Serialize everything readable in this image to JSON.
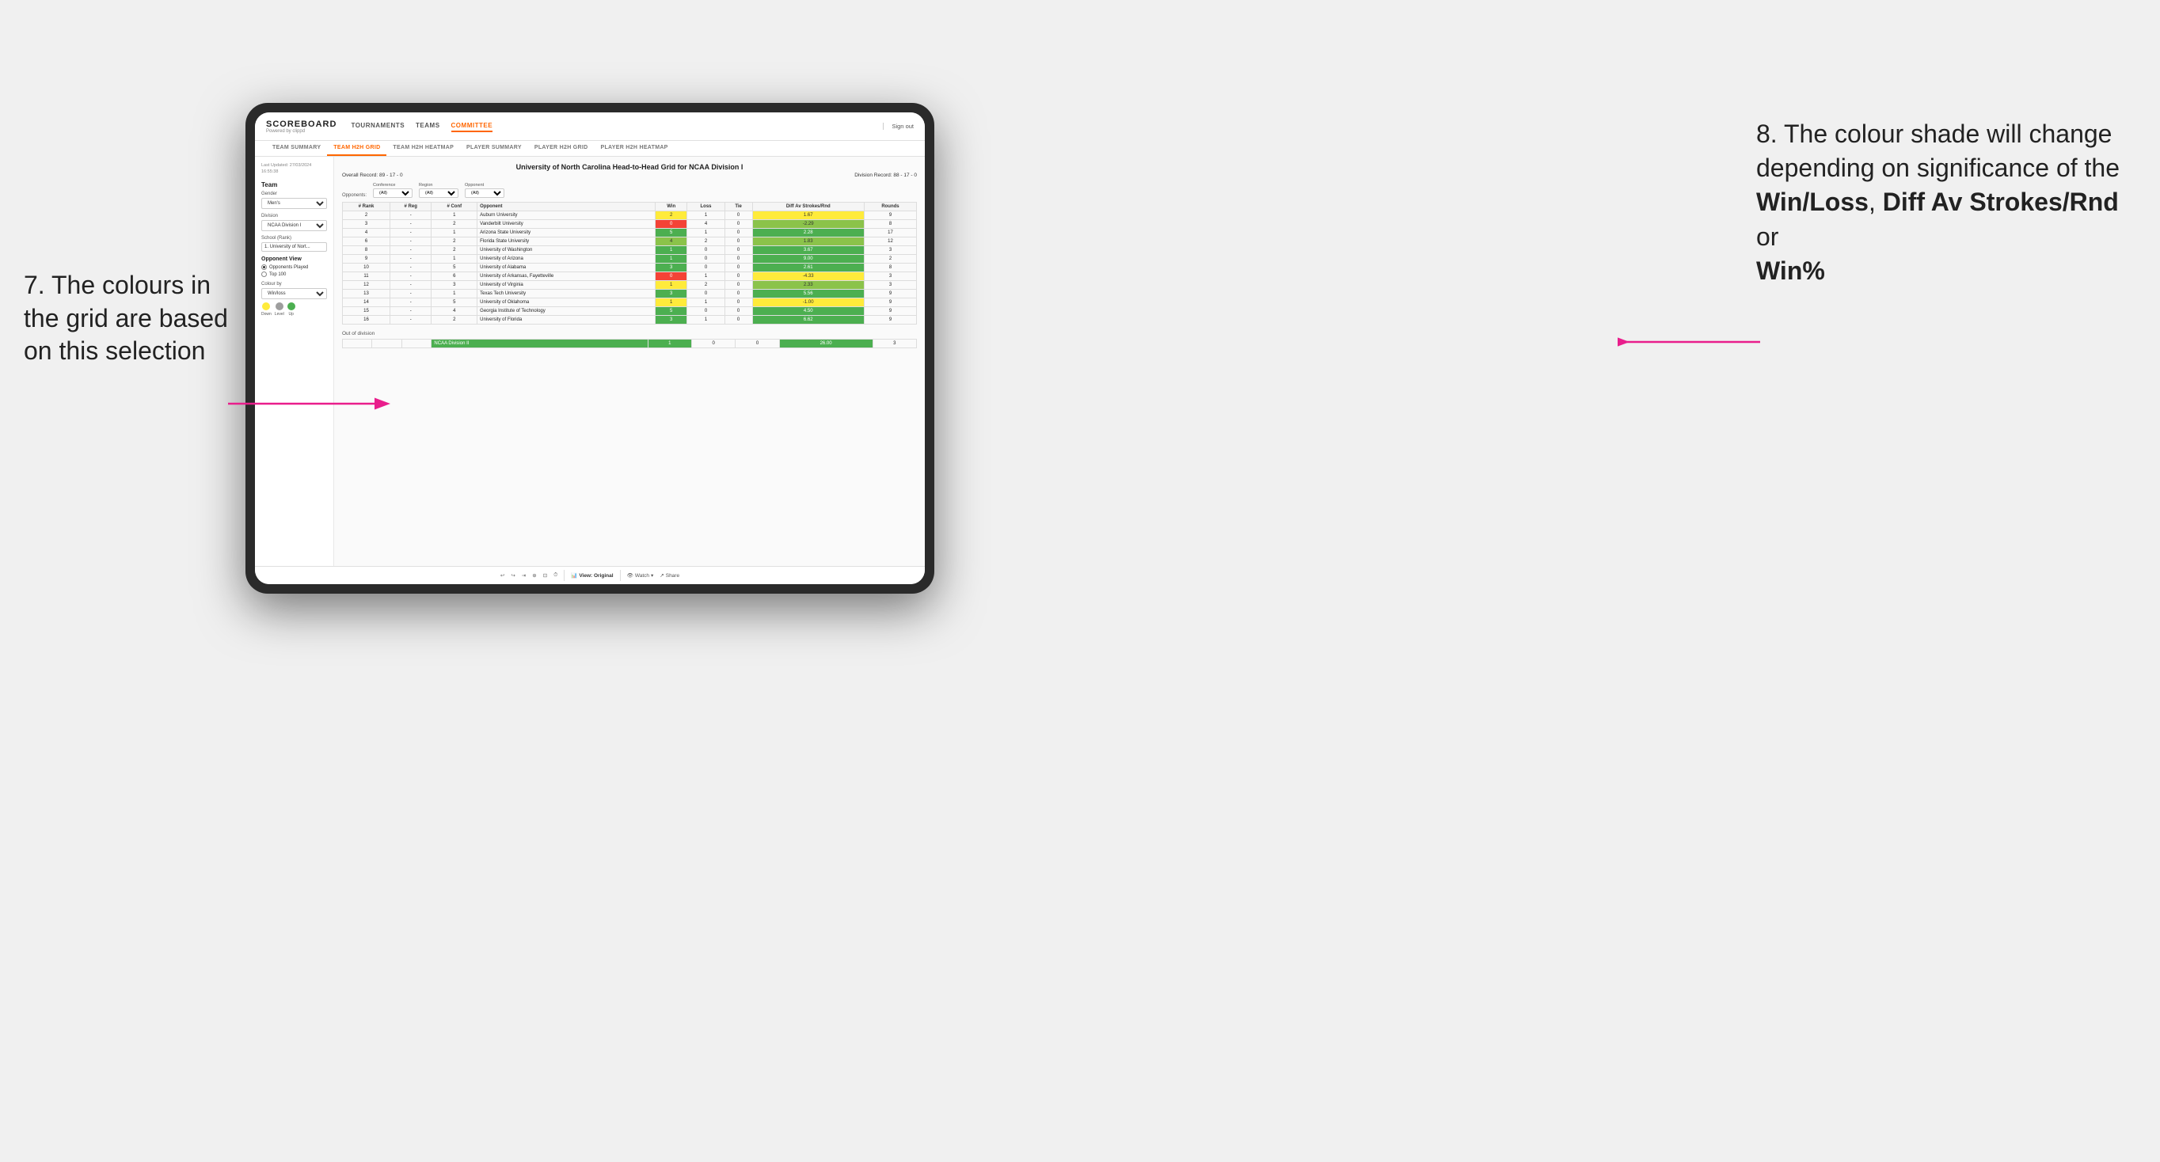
{
  "page": {
    "background": "#f0f0f0"
  },
  "annotations": {
    "left": {
      "number": "7.",
      "text": "The colours in the grid are based on this selection"
    },
    "right": {
      "number": "8.",
      "intro": "The colour shade will change depending on significance of the",
      "bold1": "Win/Loss",
      "sep1": ", ",
      "bold2": "Diff Av Strokes/Rnd",
      "sep2": " or",
      "bold3": "Win%"
    }
  },
  "app": {
    "logo": "SCOREBOARD",
    "logo_sub": "Powered by clippd",
    "nav": [
      {
        "label": "TOURNAMENTS",
        "active": false
      },
      {
        "label": "TEAMS",
        "active": false
      },
      {
        "label": "COMMITTEE",
        "active": true
      }
    ],
    "sign_out": "Sign out",
    "sub_nav": [
      {
        "label": "TEAM SUMMARY",
        "active": false
      },
      {
        "label": "TEAM H2H GRID",
        "active": true
      },
      {
        "label": "TEAM H2H HEATMAP",
        "active": false
      },
      {
        "label": "PLAYER SUMMARY",
        "active": false
      },
      {
        "label": "PLAYER H2H GRID",
        "active": false
      },
      {
        "label": "PLAYER H2H HEATMAP",
        "active": false
      }
    ]
  },
  "sidebar": {
    "last_updated_label": "Last Updated: 27/03/2024",
    "last_updated_time": "16:55:38",
    "team_label": "Team",
    "gender_label": "Gender",
    "gender_value": "Men's",
    "division_label": "Division",
    "division_value": "NCAA Division I",
    "school_label": "School (Rank)",
    "school_value": "1. University of Nort...",
    "opponent_view_label": "Opponent View",
    "opponent_options": [
      {
        "label": "Opponents Played",
        "selected": true
      },
      {
        "label": "Top 100",
        "selected": false
      }
    ],
    "colour_by_label": "Colour by",
    "colour_by_value": "Win/loss",
    "legend": [
      {
        "label": "Down",
        "color": "#ffeb3b"
      },
      {
        "label": "Level",
        "color": "#9e9e9e"
      },
      {
        "label": "Up",
        "color": "#4caf50"
      }
    ]
  },
  "grid": {
    "title": "University of North Carolina Head-to-Head Grid for NCAA Division I",
    "overall_record_label": "Overall Record:",
    "overall_record_value": "89 - 17 - 0",
    "division_record_label": "Division Record:",
    "division_record_value": "88 - 17 - 0",
    "filters": {
      "conference_label": "Conference",
      "conference_value": "(All)",
      "region_label": "Region",
      "region_value": "(All)",
      "opponent_label": "Opponent",
      "opponent_value": "(All)",
      "opponents_label": "Opponents:"
    },
    "columns": [
      "# Rank",
      "# Reg",
      "# Conf",
      "Opponent",
      "Win",
      "Loss",
      "Tie",
      "Diff Av Strokes/Rnd",
      "Rounds"
    ],
    "rows": [
      {
        "rank": "2",
        "reg": "-",
        "conf": "1",
        "opponent": "Auburn University",
        "win": "2",
        "loss": "1",
        "tie": "0",
        "diff": "1.67",
        "rounds": "9",
        "win_color": "yellow",
        "diff_color": "yellow"
      },
      {
        "rank": "3",
        "reg": "-",
        "conf": "2",
        "opponent": "Vanderbilt University",
        "win": "0",
        "loss": "4",
        "tie": "0",
        "diff": "-2.29",
        "rounds": "8",
        "win_color": "red",
        "diff_color": "green-mid"
      },
      {
        "rank": "4",
        "reg": "-",
        "conf": "1",
        "opponent": "Arizona State University",
        "win": "5",
        "loss": "1",
        "tie": "0",
        "diff": "2.28",
        "rounds": "17",
        "win_color": "green-dark",
        "diff_color": "green-dark"
      },
      {
        "rank": "6",
        "reg": "-",
        "conf": "2",
        "opponent": "Florida State University",
        "win": "4",
        "loss": "2",
        "tie": "0",
        "diff": "1.83",
        "rounds": "12",
        "win_color": "green-mid",
        "diff_color": "green-mid"
      },
      {
        "rank": "8",
        "reg": "-",
        "conf": "2",
        "opponent": "University of Washington",
        "win": "1",
        "loss": "0",
        "tie": "0",
        "diff": "3.67",
        "rounds": "3",
        "win_color": "green-dark",
        "diff_color": "green-dark"
      },
      {
        "rank": "9",
        "reg": "-",
        "conf": "1",
        "opponent": "University of Arizona",
        "win": "1",
        "loss": "0",
        "tie": "0",
        "diff": "9.00",
        "rounds": "2",
        "win_color": "green-dark",
        "diff_color": "green-dark"
      },
      {
        "rank": "10",
        "reg": "-",
        "conf": "5",
        "opponent": "University of Alabama",
        "win": "3",
        "loss": "0",
        "tie": "0",
        "diff": "2.61",
        "rounds": "8",
        "win_color": "green-dark",
        "diff_color": "green-dark"
      },
      {
        "rank": "11",
        "reg": "-",
        "conf": "6",
        "opponent": "University of Arkansas, Fayetteville",
        "win": "0",
        "loss": "1",
        "tie": "0",
        "diff": "-4.33",
        "rounds": "3",
        "win_color": "red",
        "diff_color": "yellow"
      },
      {
        "rank": "12",
        "reg": "-",
        "conf": "3",
        "opponent": "University of Virginia",
        "win": "1",
        "loss": "2",
        "tie": "0",
        "diff": "2.33",
        "rounds": "3",
        "win_color": "yellow",
        "diff_color": "green-mid"
      },
      {
        "rank": "13",
        "reg": "-",
        "conf": "1",
        "opponent": "Texas Tech University",
        "win": "3",
        "loss": "0",
        "tie": "0",
        "diff": "5.56",
        "rounds": "9",
        "win_color": "green-dark",
        "diff_color": "green-dark"
      },
      {
        "rank": "14",
        "reg": "-",
        "conf": "5",
        "opponent": "University of Oklahoma",
        "win": "1",
        "loss": "1",
        "tie": "0",
        "diff": "-1.00",
        "rounds": "9",
        "win_color": "yellow",
        "diff_color": "yellow"
      },
      {
        "rank": "15",
        "reg": "-",
        "conf": "4",
        "opponent": "Georgia Institute of Technology",
        "win": "5",
        "loss": "0",
        "tie": "0",
        "diff": "4.50",
        "rounds": "9",
        "win_color": "green-dark",
        "diff_color": "green-dark"
      },
      {
        "rank": "16",
        "reg": "-",
        "conf": "2",
        "opponent": "University of Florida",
        "win": "3",
        "loss": "1",
        "tie": "0",
        "diff": "6.62",
        "rounds": "9",
        "win_color": "green-dark",
        "diff_color": "green-dark"
      }
    ],
    "out_of_division_label": "Out of division",
    "out_of_division_rows": [
      {
        "opponent": "NCAA Division II",
        "win": "1",
        "loss": "0",
        "tie": "0",
        "diff": "26.00",
        "rounds": "3",
        "win_color": "green-dark",
        "diff_color": "green-dark"
      }
    ]
  },
  "toolbar": {
    "view_label": "View: Original",
    "watch_label": "Watch",
    "share_label": "Share"
  }
}
